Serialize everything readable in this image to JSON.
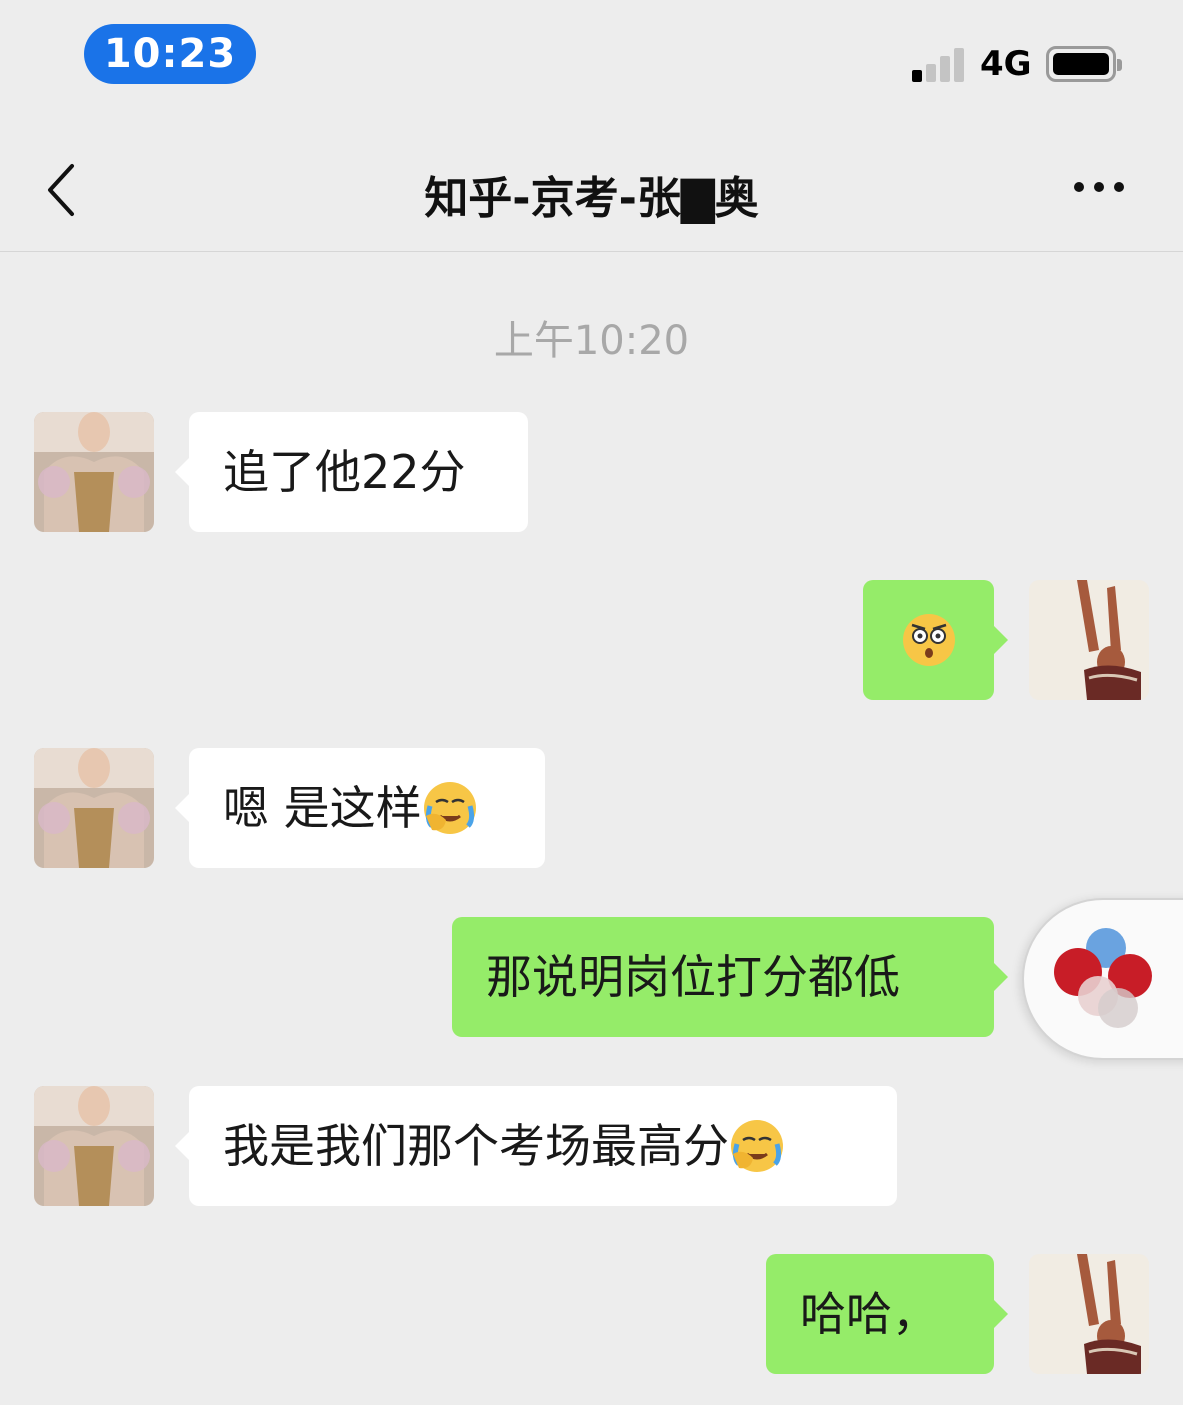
{
  "status_bar": {
    "time": "10:23",
    "network": "4G",
    "signal_bars": 1,
    "battery_level": 1.0
  },
  "header": {
    "title": "知乎-京考-张▇奥",
    "back_icon": "chevron-left-icon",
    "more_icon": "more-dots-icon"
  },
  "timestamp": "上午10:20",
  "messages": [
    {
      "side": "incoming",
      "text": "追了他22分",
      "emoji": ""
    },
    {
      "side": "outgoing",
      "text": "",
      "emoji": "shocked-face-emoji"
    },
    {
      "side": "incoming",
      "text": "嗯 是这样",
      "emoji": "facepalm-tears-emoji"
    },
    {
      "side": "outgoing",
      "text": "那说明岗位打分都低",
      "emoji": ""
    },
    {
      "side": "incoming",
      "text": "我是我们那个考场最高分",
      "emoji": "facepalm-tears-emoji"
    },
    {
      "side": "outgoing",
      "text": "哈哈，",
      "emoji": ""
    }
  ],
  "colors": {
    "background": "#ededed",
    "outgoing_bubble": "#95ec69",
    "incoming_bubble": "#ffffff",
    "time_pill": "#1a73e8"
  },
  "floating_widget": {
    "icon": "red-blue-circles-icon"
  }
}
